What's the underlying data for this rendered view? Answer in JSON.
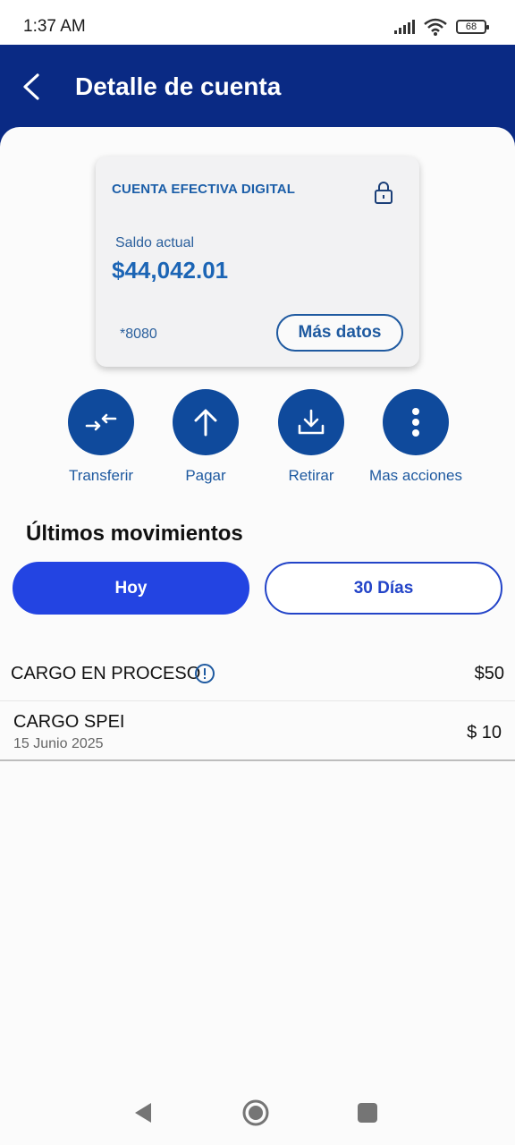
{
  "status_bar": {
    "time": "1:37 AM",
    "battery": "68"
  },
  "header": {
    "title": "Detalle de cuenta"
  },
  "account": {
    "name": "CUENTA EFECTIVA DIGITAL",
    "balance_label": "Saldo actual",
    "balance": "$44,042.01",
    "number": "*8080",
    "more_button": "Más datos"
  },
  "actions": [
    {
      "label": "Transferir",
      "icon": "transfer-icon"
    },
    {
      "label": "Pagar",
      "icon": "arrow-up-icon"
    },
    {
      "label": "Retirar",
      "icon": "download-icon"
    },
    {
      "label": "Mas acciones",
      "icon": "more-vertical-icon"
    }
  ],
  "movements": {
    "title": "Últimos movimientos",
    "tabs": [
      "Hoy",
      "30 Días"
    ],
    "active_tab": "Hoy",
    "items": [
      {
        "title": "CARGO EN PROCESO",
        "amount": "$50",
        "status_icon": "info-icon"
      },
      {
        "title": "CARGO SPEI",
        "date": "15 Junio 2025",
        "amount": "$ 10"
      }
    ]
  },
  "colors": {
    "header": "#0a2a84",
    "accent": "#0f4a9c",
    "tab_active": "#2344e2"
  }
}
